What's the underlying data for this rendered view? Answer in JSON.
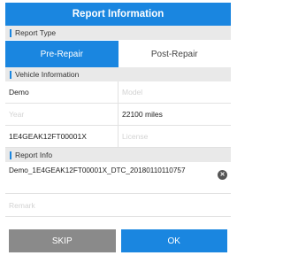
{
  "dialog": {
    "title": "Report Information"
  },
  "report_type": {
    "header": "Report Type",
    "pre_repair": "Pre-Repair",
    "post_repair": "Post-Repair"
  },
  "vehicle_info": {
    "header": "Vehicle Information",
    "make": "Demo",
    "model_placeholder": "Model",
    "year_placeholder": "Year",
    "mileage": "22100 miles",
    "vin": "1E4GEAK12FT00001X",
    "license_placeholder": "License"
  },
  "report_info": {
    "header": "Report Info",
    "report_name": "Demo_1E4GEAK12FT00001X_DTC_20180110110757",
    "extra_placeholder": "Remark"
  },
  "buttons": {
    "skip": "SKIP",
    "ok": "OK"
  },
  "colors": {
    "accent": "#1a86e0",
    "skip": "#8a8a8a",
    "section_bg": "#e9e9e9"
  }
}
